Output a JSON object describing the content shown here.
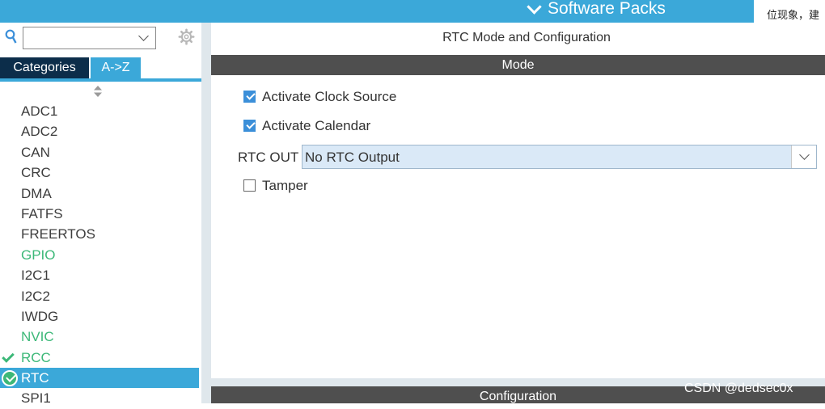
{
  "header": {
    "software_packs": "Software Packs",
    "notice_text": "位现象，建"
  },
  "left_panel": {
    "search": {
      "value": ""
    },
    "tabs": [
      {
        "label": "Categories"
      },
      {
        "label": "A->Z"
      }
    ],
    "items": [
      {
        "label": "ADC1",
        "status": "none"
      },
      {
        "label": "ADC2",
        "status": "none"
      },
      {
        "label": "CAN",
        "status": "none"
      },
      {
        "label": "CRC",
        "status": "none"
      },
      {
        "label": "DMA",
        "status": "none"
      },
      {
        "label": "FATFS",
        "status": "none"
      },
      {
        "label": "FREERTOS",
        "status": "none"
      },
      {
        "label": "GPIO",
        "status": "configured"
      },
      {
        "label": "I2C1",
        "status": "none"
      },
      {
        "label": "I2C2",
        "status": "none"
      },
      {
        "label": "IWDG",
        "status": "none"
      },
      {
        "label": "NVIC",
        "status": "configured"
      },
      {
        "label": "RCC",
        "status": "enabled"
      },
      {
        "label": "RTC",
        "status": "selected"
      },
      {
        "label": "SPI1",
        "status": "none"
      }
    ]
  },
  "main": {
    "title": "RTC Mode and Configuration",
    "mode_header": "Mode",
    "options": {
      "activate_clock_source": {
        "label": "Activate Clock Source",
        "checked": true
      },
      "activate_calendar": {
        "label": "Activate Calendar",
        "checked": true
      },
      "tamper": {
        "label": "Tamper",
        "checked": false
      }
    },
    "rtc_out": {
      "label": "RTC OUT",
      "value": "No RTC Output"
    },
    "config_header": "Configuration"
  },
  "watermark": "CSDN @dedsec0x",
  "colors": {
    "accent": "#3ba8d9",
    "dark_tab": "#0c2d4a",
    "section_bar": "#4f4f4f",
    "green": "#3cb878",
    "select_bg": "#dae9f7"
  },
  "icons": {
    "search": "search-icon",
    "settings": "gear-icon",
    "sort": "sort-arrows-icon",
    "dropdown": "chevron-down-icon"
  }
}
